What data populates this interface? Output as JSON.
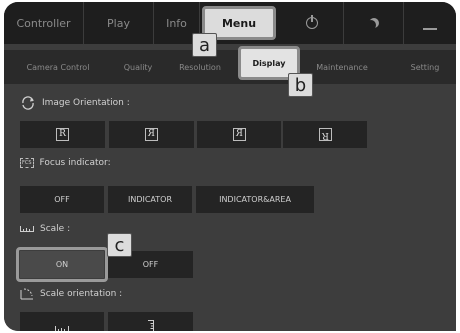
{
  "top_tabs": [
    {
      "label": "Controller"
    },
    {
      "label": "Play"
    },
    {
      "label": "Info"
    },
    {
      "label": "Menu"
    }
  ],
  "sub_tabs": [
    {
      "label": "Camera Control"
    },
    {
      "label": "Quality"
    },
    {
      "label": "Resolution"
    },
    {
      "label": "Display"
    },
    {
      "label": "Maintenance"
    },
    {
      "label": "Setting"
    }
  ],
  "callouts": {
    "a": "a",
    "b": "b",
    "c": "c"
  },
  "sections": {
    "image_orientation": {
      "title": "Image Orientation :",
      "buttons": [
        "R",
        "R",
        "R",
        "R"
      ]
    },
    "focus_indicator": {
      "icon_text": "FCS",
      "title": "Focus indicator:",
      "buttons": [
        "OFF",
        "INDICATOR",
        "INDICATOR&AREA"
      ]
    },
    "scale": {
      "title": "Scale :",
      "buttons": [
        "ON",
        "OFF"
      ],
      "selected": "ON"
    },
    "scale_orientation": {
      "title": "Scale orientation :"
    }
  },
  "icons": {
    "power": "power-icon",
    "night": "moon-icon",
    "minimize": "minimize-icon"
  },
  "colors": {
    "background": "#3d3d3d",
    "topbar": "#1e1e1e",
    "button": "#242424",
    "active_tab": "#dcdcdc"
  }
}
